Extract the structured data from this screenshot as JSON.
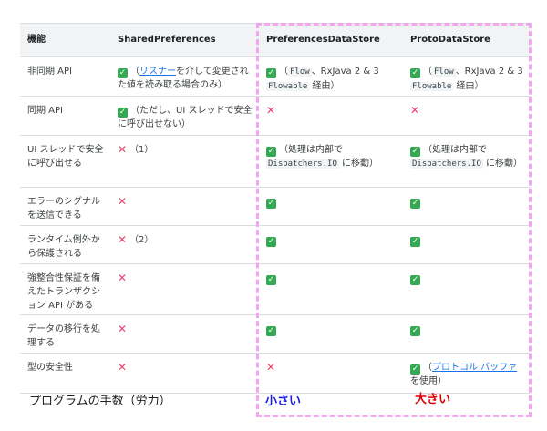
{
  "headers": [
    "機能",
    "SharedPreferences",
    "PreferencesDataStore",
    "ProtoDataStore"
  ],
  "rows": [
    {
      "feature": "非同期 API",
      "sp": {
        "mark": "check",
        "pre": "（",
        "link": "リスナー",
        "post": "を介して変更された値を読み取る場合のみ）"
      },
      "pds": {
        "mark": "check",
        "pre": "（",
        "code1": "Flow",
        "mid": "、RxJava 2 & 3 ",
        "code2": "Flowable",
        "post": " 経由）"
      },
      "proto": {
        "mark": "check",
        "pre": "（",
        "code1": "Flow",
        "mid": "、RxJava 2 & 3 ",
        "code2": "Flowable",
        "post": " 経由）"
      }
    },
    {
      "feature": "同期 API",
      "sp": {
        "mark": "check",
        "text": "（ただし、UI スレッドで安全に呼び出せない）"
      },
      "pds": {
        "mark": "cross"
      },
      "proto": {
        "mark": "cross"
      }
    },
    {
      "feature": "UI スレッドで安全に呼び出せる",
      "sp": {
        "mark": "cross",
        "text": "（1）"
      },
      "pds": {
        "mark": "check",
        "pre": "（処理は内部で ",
        "code": "Dispatchers.IO",
        "post": " に移動）"
      },
      "proto": {
        "mark": "check",
        "pre": "（処理は内部で ",
        "code": "Dispatchers.IO",
        "post": " に移動）"
      }
    },
    {
      "feature": "エラーのシグナルを送信できる",
      "sp": {
        "mark": "cross"
      },
      "pds": {
        "mark": "check"
      },
      "proto": {
        "mark": "check"
      }
    },
    {
      "feature": "ランタイム例外から保護される",
      "sp": {
        "mark": "cross",
        "text": "（2）"
      },
      "pds": {
        "mark": "check"
      },
      "proto": {
        "mark": "check"
      }
    },
    {
      "feature": "強整合性保証を備えたトランザクション API がある",
      "sp": {
        "mark": "cross"
      },
      "pds": {
        "mark": "check"
      },
      "proto": {
        "mark": "check"
      }
    },
    {
      "feature": "データの移行を処理する",
      "sp": {
        "mark": "cross"
      },
      "pds": {
        "mark": "check"
      },
      "proto": {
        "mark": "check"
      }
    },
    {
      "feature": "型の安全性",
      "sp": {
        "mark": "cross"
      },
      "pds": {
        "mark": "cross"
      },
      "proto": {
        "mark": "check",
        "pre": "（",
        "link": "プロトコル バッファ",
        "post": "を使用）"
      }
    }
  ],
  "footer": {
    "label": "プログラムの手数（労力）",
    "small": "小さい",
    "large": "大きい"
  },
  "colors": {
    "check": "#34a853",
    "cross": "#e8456b",
    "link": "#1a73e8",
    "highlight_border": "#f7a4f0",
    "small_text": "#1a1ae6",
    "large_text": "#e00000"
  }
}
